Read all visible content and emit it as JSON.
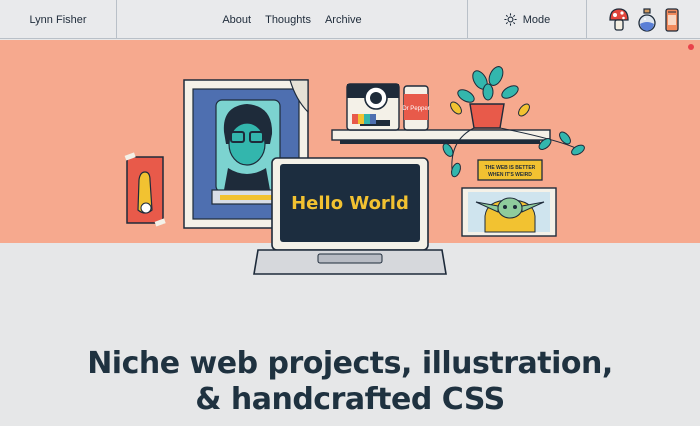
{
  "header": {
    "brand": "Lynn Fisher",
    "nav": [
      "About",
      "Thoughts",
      "Archive"
    ],
    "mode_label": "Mode",
    "mode_icon": "sun-icon",
    "sticker_icons": [
      "mushroom-icon",
      "potion-bottle-icon",
      "soda-can-icon"
    ]
  },
  "hero": {
    "laptop_screen_text": "Hello World",
    "sign_line1": "THE WEB IS BETTER",
    "sign_line2": "WHEN IT'S WEIRD",
    "soda_label": "Dr Pepper",
    "colors": {
      "background": "#f6a98e",
      "accent": "#f2c231",
      "laptop_screen": "#1c2d3f"
    }
  },
  "headline": {
    "line1": "Niche web projects, illustration,",
    "line2": "& handcrafted CSS"
  }
}
